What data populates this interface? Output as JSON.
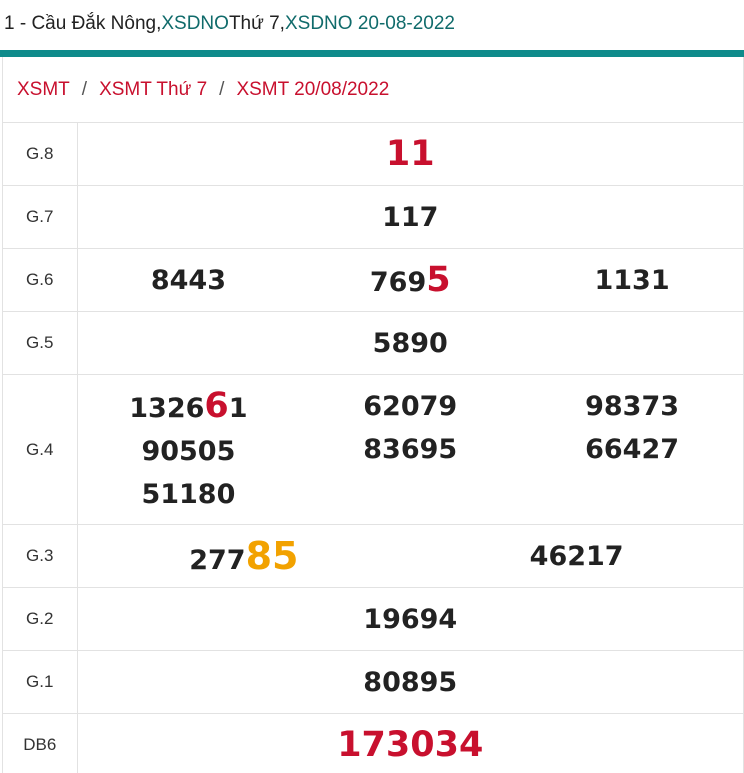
{
  "header": {
    "prefix": "1 - Cầu Đắk Nông, ",
    "link1": "XSDNO",
    "mid": " Thứ 7, ",
    "link2": "XSDNO 20-08-2022"
  },
  "breadcrumb": {
    "items": [
      "XSMT",
      "XSMT Thứ 7",
      "XSMT 20/08/2022"
    ],
    "separator": "/"
  },
  "results": {
    "g8": {
      "label": "G.8",
      "value": "11"
    },
    "g7": {
      "label": "G.7",
      "value": "117"
    },
    "g6": {
      "label": "G.6",
      "v1": "8443",
      "v2_main": "769",
      "v2_hl": "5",
      "v3": "1131"
    },
    "g5": {
      "label": "G.5",
      "value": "5890"
    },
    "g4": {
      "label": "G.4",
      "v1_main": "1326",
      "v1_hl": "6",
      "v1_tail": "1",
      "v2": "62079",
      "v3": "98373",
      "v4": "90505",
      "v5": "83695",
      "v6": "66427",
      "v7": "51180"
    },
    "g3": {
      "label": "G.3",
      "v1_main": "277",
      "v1_hl": "85",
      "v2": "46217"
    },
    "g2": {
      "label": "G.2",
      "value": "19694"
    },
    "g1": {
      "label": "G.1",
      "value": "80895"
    },
    "db": {
      "label": "DB6",
      "value": "173034"
    }
  },
  "colors": {
    "accent_red": "#c8102e",
    "accent_orange": "#f2a200",
    "teal": "#0e8b8b"
  }
}
